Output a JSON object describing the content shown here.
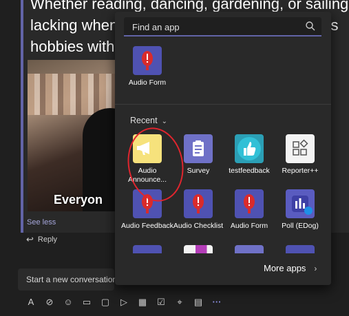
{
  "conversation": {
    "post_lines": [
      "Whether reading, dancing, gardening, or sailing is y",
      "lacking when c                                             his",
      "hobbies with r"
    ],
    "video_caption": "Everyon",
    "see_less": "See less",
    "reply": "Reply",
    "compose_placeholder": "Start a new conversation"
  },
  "flyout": {
    "search_placeholder": "Find an app",
    "pinned_apps": [
      {
        "label": "Audio Form",
        "icon": "microphone-icon"
      }
    ],
    "recent_label": "Recent",
    "recent_apps": [
      {
        "label": "Audio Announce...",
        "icon": "megaphone-icon"
      },
      {
        "label": "Survey",
        "icon": "clipboard-icon"
      },
      {
        "label": "testfeedback",
        "icon": "thumbs-up-icon"
      },
      {
        "label": "Reporter++",
        "icon": "shapes-icon"
      },
      {
        "label": "Audio Feedback",
        "icon": "microphone-icon"
      },
      {
        "label": "Audio Checklist",
        "icon": "microphone-icon"
      },
      {
        "label": "Audio Form",
        "icon": "microphone-icon"
      },
      {
        "label": "Poll (EDog)",
        "icon": "poll-icon"
      }
    ],
    "more_apps": "More apps"
  },
  "colors": {
    "accent": "#6264a7",
    "highlight_circle": "#e0252e",
    "mic_red": "#d92b2b"
  }
}
